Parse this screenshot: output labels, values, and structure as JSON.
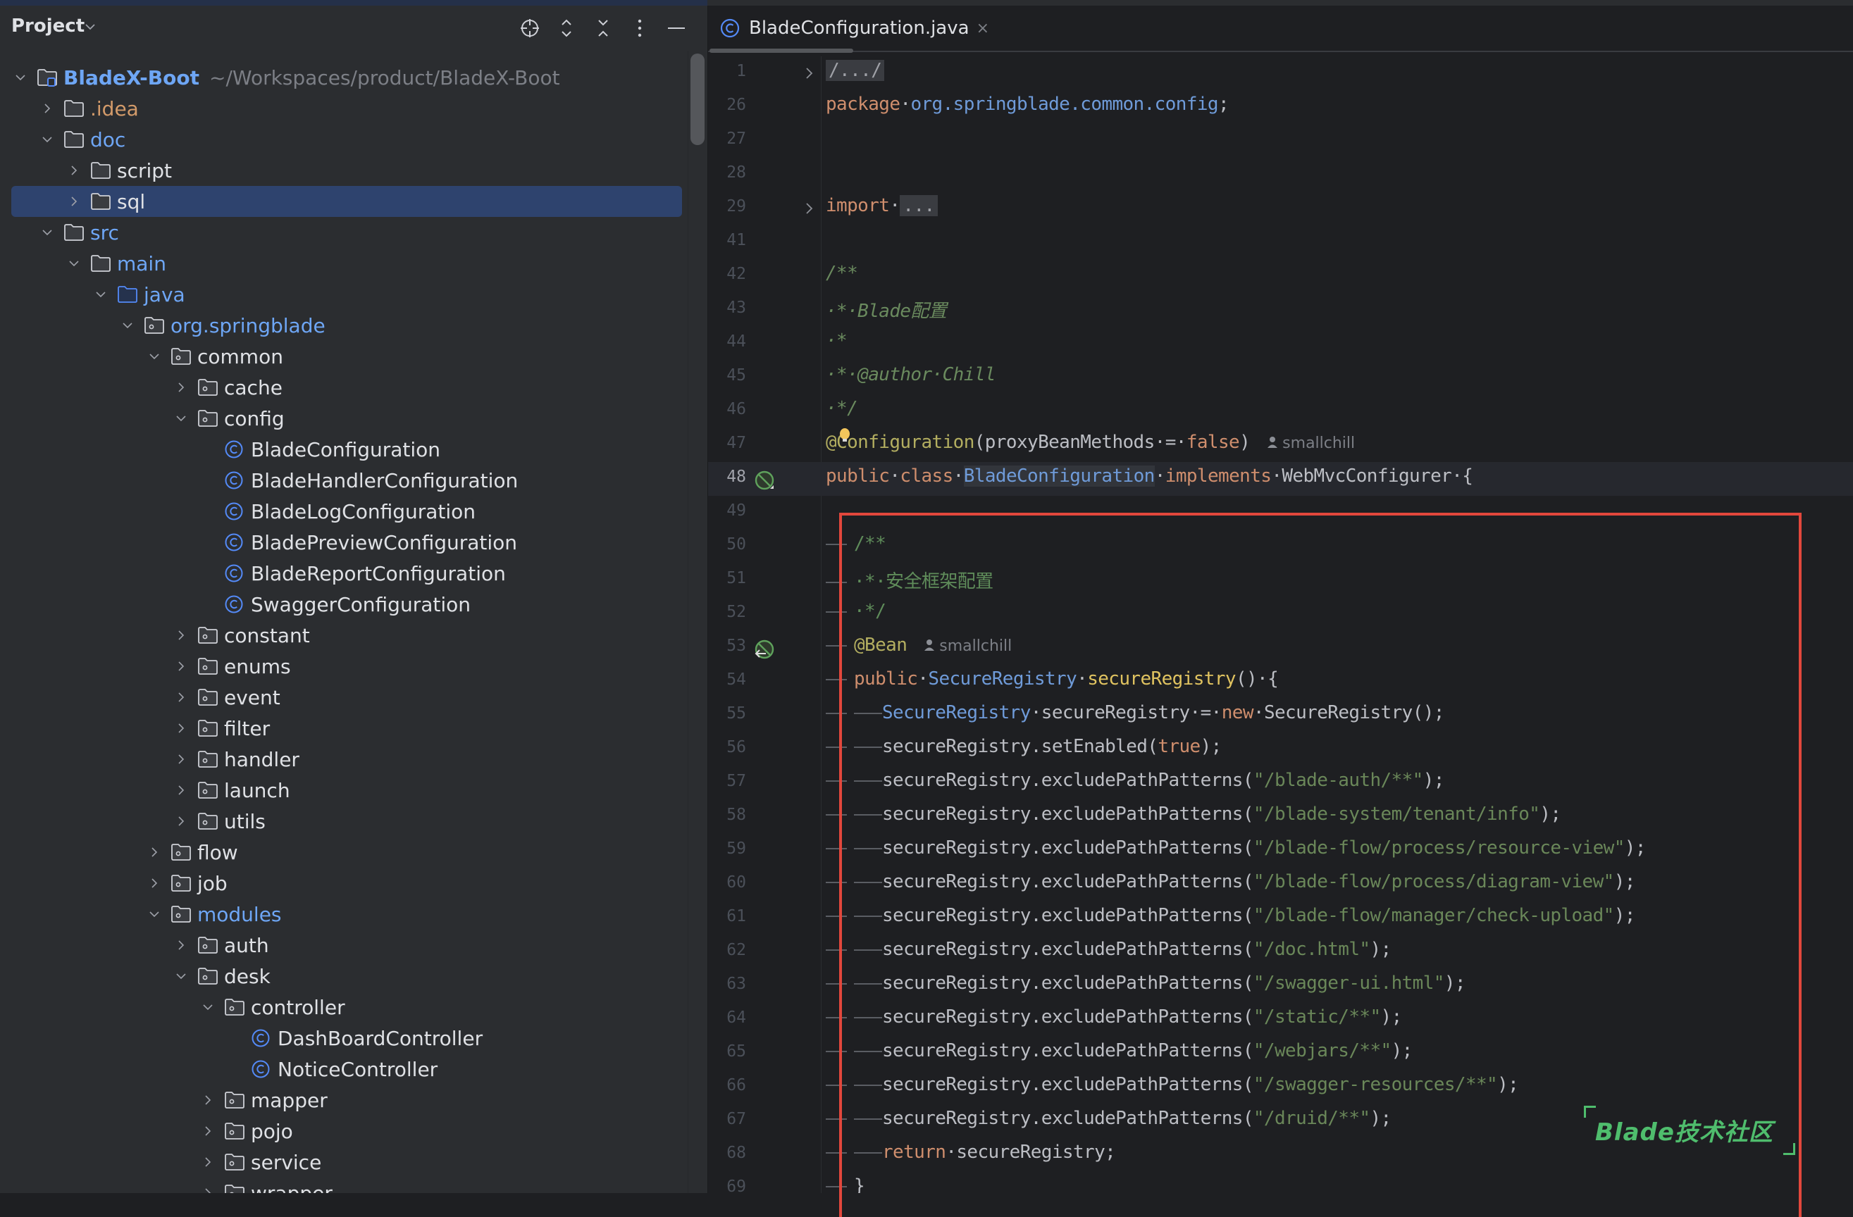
{
  "sidebar": {
    "title": "Project",
    "toolbar": {
      "locate": "locate-icon",
      "expand_all": "expand-all-icon",
      "collapse_all": "collapse-all-icon",
      "options": "more-options-icon",
      "hide": "minimize-icon"
    },
    "tree": [
      {
        "depth": 0,
        "label": "BladeX-Boot",
        "path": "~/Workspaces/product/BladeX-Boot",
        "kind": "module",
        "state": "open",
        "style": "blue-bold"
      },
      {
        "depth": 1,
        "label": ".idea",
        "kind": "folder",
        "state": "closed",
        "style": "orange"
      },
      {
        "depth": 1,
        "label": "doc",
        "kind": "folder",
        "state": "open",
        "style": "blue"
      },
      {
        "depth": 2,
        "label": "script",
        "kind": "folder",
        "state": "closed",
        "style": "normal"
      },
      {
        "depth": 2,
        "label": "sql",
        "kind": "folder",
        "state": "closed",
        "style": "normal",
        "selected": true
      },
      {
        "depth": 1,
        "label": "src",
        "kind": "folder",
        "state": "open",
        "style": "blue"
      },
      {
        "depth": 2,
        "label": "main",
        "kind": "folder",
        "state": "open",
        "style": "blue"
      },
      {
        "depth": 3,
        "label": "java",
        "kind": "source-folder",
        "state": "open",
        "style": "blue"
      },
      {
        "depth": 4,
        "label": "org.springblade",
        "kind": "package",
        "state": "open",
        "style": "blue"
      },
      {
        "depth": 5,
        "label": "common",
        "kind": "package",
        "state": "open",
        "style": "normal"
      },
      {
        "depth": 6,
        "label": "cache",
        "kind": "package",
        "state": "closed",
        "style": "normal"
      },
      {
        "depth": 6,
        "label": "config",
        "kind": "package",
        "state": "open",
        "style": "normal"
      },
      {
        "depth": 7,
        "label": "BladeConfiguration",
        "kind": "class",
        "state": "leaf",
        "style": "normal"
      },
      {
        "depth": 7,
        "label": "BladeHandlerConfiguration",
        "kind": "class",
        "state": "leaf",
        "style": "normal"
      },
      {
        "depth": 7,
        "label": "BladeLogConfiguration",
        "kind": "class",
        "state": "leaf",
        "style": "normal"
      },
      {
        "depth": 7,
        "label": "BladePreviewConfiguration",
        "kind": "class",
        "state": "leaf",
        "style": "normal"
      },
      {
        "depth": 7,
        "label": "BladeReportConfiguration",
        "kind": "class",
        "state": "leaf",
        "style": "normal"
      },
      {
        "depth": 7,
        "label": "SwaggerConfiguration",
        "kind": "class",
        "state": "leaf",
        "style": "normal"
      },
      {
        "depth": 6,
        "label": "constant",
        "kind": "package",
        "state": "closed",
        "style": "normal"
      },
      {
        "depth": 6,
        "label": "enums",
        "kind": "package",
        "state": "closed",
        "style": "normal"
      },
      {
        "depth": 6,
        "label": "event",
        "kind": "package",
        "state": "closed",
        "style": "normal"
      },
      {
        "depth": 6,
        "label": "filter",
        "kind": "package",
        "state": "closed",
        "style": "normal"
      },
      {
        "depth": 6,
        "label": "handler",
        "kind": "package",
        "state": "closed",
        "style": "normal"
      },
      {
        "depth": 6,
        "label": "launch",
        "kind": "package",
        "state": "closed",
        "style": "normal"
      },
      {
        "depth": 6,
        "label": "utils",
        "kind": "package",
        "state": "closed",
        "style": "normal"
      },
      {
        "depth": 5,
        "label": "flow",
        "kind": "package",
        "state": "closed",
        "style": "normal"
      },
      {
        "depth": 5,
        "label": "job",
        "kind": "package",
        "state": "closed",
        "style": "normal"
      },
      {
        "depth": 5,
        "label": "modules",
        "kind": "package",
        "state": "open",
        "style": "blue"
      },
      {
        "depth": 6,
        "label": "auth",
        "kind": "package",
        "state": "closed",
        "style": "normal"
      },
      {
        "depth": 6,
        "label": "desk",
        "kind": "package",
        "state": "open",
        "style": "normal"
      },
      {
        "depth": 7,
        "label": "controller",
        "kind": "package",
        "state": "open",
        "style": "normal"
      },
      {
        "depth": 8,
        "label": "DashBoardController",
        "kind": "class",
        "state": "leaf",
        "style": "normal"
      },
      {
        "depth": 8,
        "label": "NoticeController",
        "kind": "class",
        "state": "leaf",
        "style": "normal"
      },
      {
        "depth": 7,
        "label": "mapper",
        "kind": "package",
        "state": "closed",
        "style": "normal"
      },
      {
        "depth": 7,
        "label": "pojo",
        "kind": "package",
        "state": "closed",
        "style": "normal"
      },
      {
        "depth": 7,
        "label": "service",
        "kind": "package",
        "state": "closed",
        "style": "normal"
      },
      {
        "depth": 7,
        "label": "wrapper",
        "kind": "package",
        "state": "closed",
        "style": "normal"
      }
    ]
  },
  "editor": {
    "tab": {
      "label": "BladeConfiguration.java",
      "close": "×",
      "icon": "class-icon"
    },
    "current_line": "48",
    "lines": [
      {
        "n": "1",
        "fold": true,
        "tokens": [
          [
            "folded",
            "/.../"
          ]
        ]
      },
      {
        "n": "26",
        "tokens": [
          [
            "kw",
            "package"
          ],
          [
            "",
            "·"
          ],
          [
            "pkg",
            "org.springblade.common.config"
          ],
          [
            "",
            ";"
          ]
        ]
      },
      {
        "n": "27",
        "tokens": []
      },
      {
        "n": "28",
        "tokens": []
      },
      {
        "n": "29",
        "fold": true,
        "tokens": [
          [
            "kw",
            "import"
          ],
          [
            "",
            "·"
          ],
          [
            "folded",
            "..."
          ]
        ]
      },
      {
        "n": "41",
        "tokens": []
      },
      {
        "n": "42",
        "tokens": [
          [
            "cmt",
            "/**"
          ]
        ]
      },
      {
        "n": "43",
        "tokens": [
          [
            "cmt",
            "·*·Blade配置"
          ]
        ]
      },
      {
        "n": "44",
        "tokens": [
          [
            "cmt",
            "·*"
          ]
        ]
      },
      {
        "n": "45",
        "tokens": [
          [
            "cmt",
            "·*·@author·Chill"
          ]
        ]
      },
      {
        "n": "46",
        "tokens": [
          [
            "cmt",
            "·*/"
          ]
        ]
      },
      {
        "n": "47",
        "tokens": [
          [
            "ann",
            "@Configuration"
          ],
          [
            "",
            "(proxyBeanMethods·=·"
          ],
          [
            "kw",
            "false"
          ],
          [
            "",
            ")"
          ]
        ],
        "author": "smallchill",
        "bulb": true
      },
      {
        "n": "48",
        "gutter": "bean-icon",
        "tokens": [
          [
            "kw",
            "public"
          ],
          [
            "",
            "·"
          ],
          [
            "kw",
            "class"
          ],
          [
            "",
            "·"
          ],
          [
            "type hl",
            "BladeConfiguration"
          ],
          [
            "",
            "·"
          ],
          [
            "kw",
            "implements"
          ],
          [
            "",
            "·WebMvcConfigurer·{"
          ]
        ]
      },
      {
        "n": "49",
        "tokens": []
      },
      {
        "n": "50",
        "indent": 1,
        "tokens": [
          [
            "cmt-n",
            "/**"
          ]
        ]
      },
      {
        "n": "51",
        "indent": 1,
        "tokens": [
          [
            "cmt-n",
            "·*·安全框架配置"
          ]
        ]
      },
      {
        "n": "52",
        "indent": 1,
        "tokens": [
          [
            "cmt-n",
            "·*/"
          ]
        ]
      },
      {
        "n": "53",
        "indent": 1,
        "gutter": "bean-method-icon",
        "tokens": [
          [
            "ann",
            "@Bean"
          ]
        ],
        "author": "smallchill"
      },
      {
        "n": "54",
        "indent": 1,
        "tokens": [
          [
            "kw",
            "public"
          ],
          [
            "",
            "·"
          ],
          [
            "type",
            "SecureRegistry"
          ],
          [
            "",
            "·"
          ],
          [
            "fn",
            "secureRegistry"
          ],
          [
            "",
            "()·{"
          ]
        ]
      },
      {
        "n": "55",
        "indent": 2,
        "tokens": [
          [
            "type",
            "SecureRegistry"
          ],
          [
            "",
            "·secureRegistry·=·"
          ],
          [
            "kw",
            "new"
          ],
          [
            "",
            "·SecureRegistry();"
          ]
        ]
      },
      {
        "n": "56",
        "indent": 2,
        "tokens": [
          [
            "",
            "secureRegistry.setEnabled("
          ],
          [
            "kw",
            "true"
          ],
          [
            "",
            ");"
          ]
        ]
      },
      {
        "n": "57",
        "indent": 2,
        "tokens": [
          [
            "",
            "secureRegistry.excludePathPatterns("
          ],
          [
            "str",
            "\"/blade-auth/**\""
          ],
          [
            "",
            ");"
          ]
        ]
      },
      {
        "n": "58",
        "indent": 2,
        "tokens": [
          [
            "",
            "secureRegistry.excludePathPatterns("
          ],
          [
            "str",
            "\"/blade-system/tenant/info\""
          ],
          [
            "",
            ");"
          ]
        ]
      },
      {
        "n": "59",
        "indent": 2,
        "tokens": [
          [
            "",
            "secureRegistry.excludePathPatterns("
          ],
          [
            "str",
            "\"/blade-flow/process/resource-view\""
          ],
          [
            "",
            ");"
          ]
        ]
      },
      {
        "n": "60",
        "indent": 2,
        "tokens": [
          [
            "",
            "secureRegistry.excludePathPatterns("
          ],
          [
            "str",
            "\"/blade-flow/process/diagram-view\""
          ],
          [
            "",
            ");"
          ]
        ]
      },
      {
        "n": "61",
        "indent": 2,
        "tokens": [
          [
            "",
            "secureRegistry.excludePathPatterns("
          ],
          [
            "str",
            "\"/blade-flow/manager/check-upload\""
          ],
          [
            "",
            ");"
          ]
        ]
      },
      {
        "n": "62",
        "indent": 2,
        "tokens": [
          [
            "",
            "secureRegistry.excludePathPatterns("
          ],
          [
            "str",
            "\"/doc.html\""
          ],
          [
            "",
            ");"
          ]
        ]
      },
      {
        "n": "63",
        "indent": 2,
        "tokens": [
          [
            "",
            "secureRegistry.excludePathPatterns("
          ],
          [
            "str",
            "\"/swagger-ui.html\""
          ],
          [
            "",
            ");"
          ]
        ]
      },
      {
        "n": "64",
        "indent": 2,
        "tokens": [
          [
            "",
            "secureRegistry.excludePathPatterns("
          ],
          [
            "str",
            "\"/static/**\""
          ],
          [
            "",
            ");"
          ]
        ]
      },
      {
        "n": "65",
        "indent": 2,
        "tokens": [
          [
            "",
            "secureRegistry.excludePathPatterns("
          ],
          [
            "str",
            "\"/webjars/**\""
          ],
          [
            "",
            ");"
          ]
        ]
      },
      {
        "n": "66",
        "indent": 2,
        "tokens": [
          [
            "",
            "secureRegistry.excludePathPatterns("
          ],
          [
            "str",
            "\"/swagger-resources/**\""
          ],
          [
            "",
            ");"
          ]
        ]
      },
      {
        "n": "67",
        "indent": 2,
        "tokens": [
          [
            "",
            "secureRegistry.excludePathPatterns("
          ],
          [
            "str",
            "\"/druid/**\""
          ],
          [
            "",
            ");"
          ]
        ]
      },
      {
        "n": "68",
        "indent": 2,
        "tokens": [
          [
            "kw",
            "return"
          ],
          [
            "",
            "·secureRegistry;"
          ]
        ]
      },
      {
        "n": "69",
        "indent": 1,
        "tokens": [
          [
            "",
            "}"
          ]
        ]
      }
    ]
  },
  "annotation": {
    "highlight_box_color": "#e2473c",
    "watermark": "Blade技术社区",
    "watermark_color": "#4fbd6d"
  }
}
